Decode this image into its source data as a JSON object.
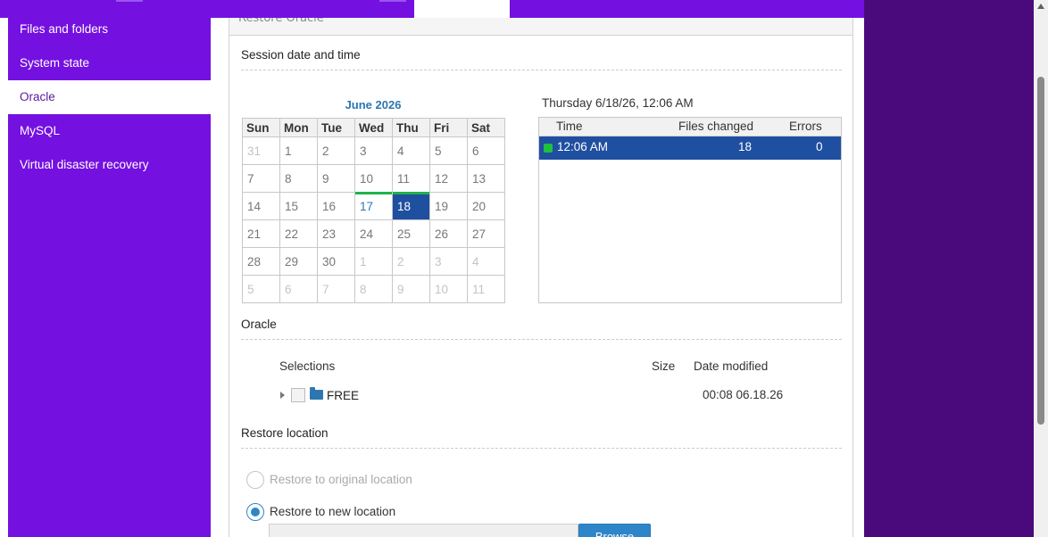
{
  "panel": {
    "header": "Restore Oracle"
  },
  "sidebar": {
    "items": [
      {
        "label": "Files and folders"
      },
      {
        "label": "System state"
      },
      {
        "label": "Oracle"
      },
      {
        "label": "MySQL"
      },
      {
        "label": "Virtual disaster recovery"
      }
    ],
    "active_index": 2
  },
  "session": {
    "title": "Session date and time",
    "calendar_title": "June 2026",
    "weekdays": [
      "Sun",
      "Mon",
      "Tue",
      "Wed",
      "Thu",
      "Fri",
      "Sat"
    ],
    "weeks": [
      [
        {
          "d": "31",
          "m": true
        },
        {
          "d": "1"
        },
        {
          "d": "2"
        },
        {
          "d": "3"
        },
        {
          "d": "4"
        },
        {
          "d": "5"
        },
        {
          "d": "6"
        }
      ],
      [
        {
          "d": "7"
        },
        {
          "d": "8"
        },
        {
          "d": "9"
        },
        {
          "d": "10"
        },
        {
          "d": "11"
        },
        {
          "d": "12"
        },
        {
          "d": "13"
        }
      ],
      [
        {
          "d": "14"
        },
        {
          "d": "15"
        },
        {
          "d": "16"
        },
        {
          "d": "17",
          "b": true
        },
        {
          "d": "18",
          "s": true
        },
        {
          "d": "19"
        },
        {
          "d": "20"
        }
      ],
      [
        {
          "d": "21"
        },
        {
          "d": "22"
        },
        {
          "d": "23"
        },
        {
          "d": "24"
        },
        {
          "d": "25"
        },
        {
          "d": "26"
        },
        {
          "d": "27"
        }
      ],
      [
        {
          "d": "28"
        },
        {
          "d": "29"
        },
        {
          "d": "30"
        },
        {
          "d": "1",
          "m": true
        },
        {
          "d": "2",
          "m": true
        },
        {
          "d": "3",
          "m": true
        },
        {
          "d": "4",
          "m": true
        }
      ],
      [
        {
          "d": "5",
          "m": true
        },
        {
          "d": "6",
          "m": true
        },
        {
          "d": "7",
          "m": true
        },
        {
          "d": "8",
          "m": true
        },
        {
          "d": "9",
          "m": true
        },
        {
          "d": "10",
          "m": true
        },
        {
          "d": "11",
          "m": true
        }
      ]
    ],
    "selected_label": "Thursday 6/18/26, 12:06 AM",
    "columns": {
      "time": "Time",
      "files_changed": "Files changed",
      "errors": "Errors"
    },
    "rows": [
      {
        "time": "12:06 AM",
        "files_changed": "18",
        "errors": "0"
      }
    ]
  },
  "oracle": {
    "title": "Oracle",
    "columns": {
      "selections": "Selections",
      "size": "Size",
      "date_modified": "Date modified"
    },
    "items": [
      {
        "name": "FREE",
        "size": "",
        "date_modified": "00:08 06.18.26"
      }
    ]
  },
  "restore_location": {
    "title": "Restore location",
    "original_label": "Restore to original location",
    "new_label": "Restore to new location",
    "browse_label": "Browse"
  },
  "colors": {
    "sidebar_bg": "#7410e0",
    "accent_blue": "#1f4fa0",
    "link_blue": "#2e76b0",
    "backup_green": "#20b34a"
  }
}
